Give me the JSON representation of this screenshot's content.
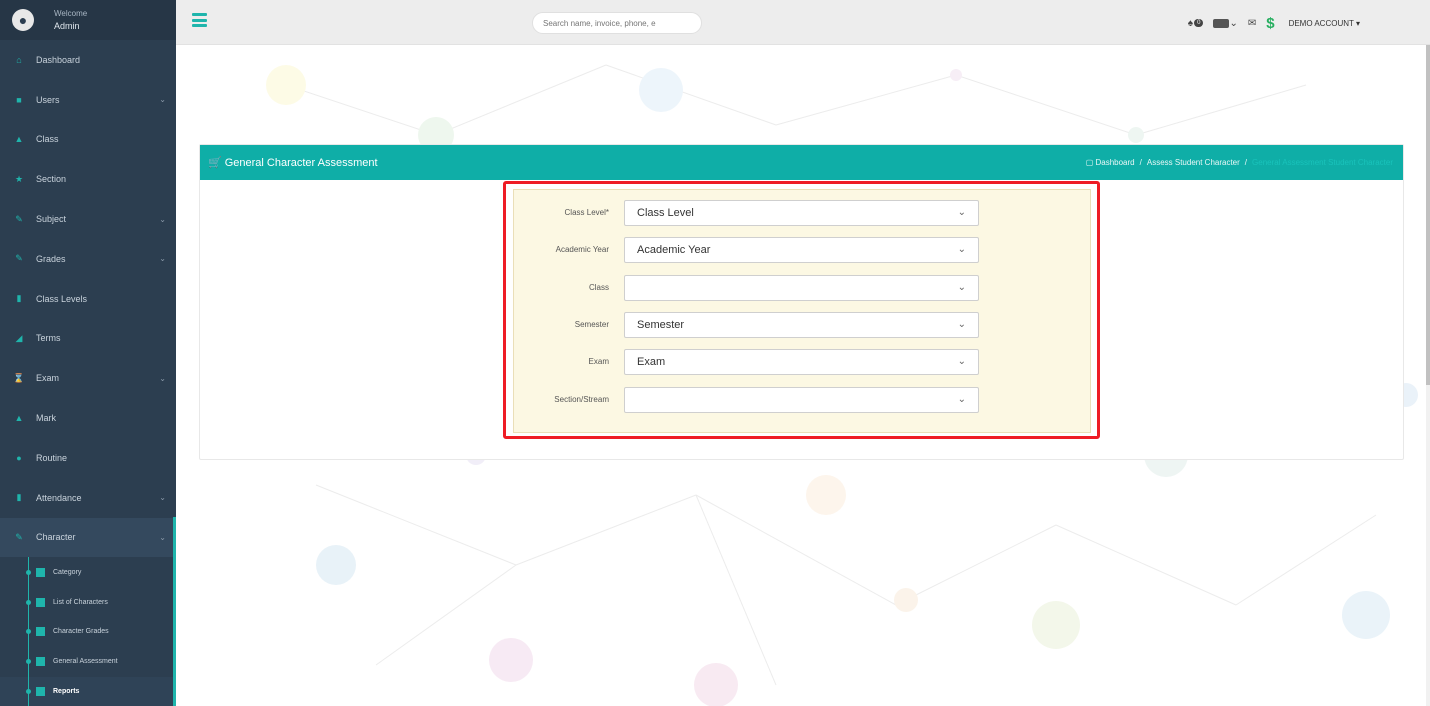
{
  "sidebar": {
    "welcome": "Welcome",
    "user": "Admin",
    "items": [
      {
        "label": "Dashboard",
        "icon": "home-icon"
      },
      {
        "label": "Users",
        "icon": "users-icon",
        "caret": true
      },
      {
        "label": "Class",
        "icon": "class-icon"
      },
      {
        "label": "Section",
        "icon": "star-icon"
      },
      {
        "label": "Subject",
        "icon": "edit-icon",
        "caret": true
      },
      {
        "label": "Grades",
        "icon": "edit-icon",
        "caret": true
      },
      {
        "label": "Class Levels",
        "icon": "level-icon"
      },
      {
        "label": "Terms",
        "icon": "chart-icon"
      },
      {
        "label": "Exam",
        "icon": "hourglass-icon",
        "caret": true
      },
      {
        "label": "Mark",
        "icon": "user-icon"
      },
      {
        "label": "Routine",
        "icon": "circle-icon"
      },
      {
        "label": "Attendance",
        "icon": "bookmark-icon",
        "caret": true
      },
      {
        "label": "Character",
        "icon": "edit-icon",
        "caret": true
      }
    ],
    "subitems": [
      {
        "label": "Category"
      },
      {
        "label": "List of Characters"
      },
      {
        "label": "Character Grades"
      },
      {
        "label": "General Assessment"
      },
      {
        "label": "Reports"
      }
    ]
  },
  "topbar": {
    "search_placeholder": "Search name, invoice, phone, e",
    "badge_count": "0",
    "account": "DEMO ACCOUNT ▾"
  },
  "panel": {
    "title": "General Character Assessment",
    "breadcrumb": [
      "Dashboard",
      "Assess Student Character",
      "General Assessment Student Character"
    ]
  },
  "form": {
    "fields": [
      {
        "label": "Class Level*",
        "value": "Class Level"
      },
      {
        "label": "Academic Year",
        "value": "Academic Year"
      },
      {
        "label": "Class",
        "value": ""
      },
      {
        "label": "Semester",
        "value": "Semester"
      },
      {
        "label": "Exam",
        "value": "Exam"
      },
      {
        "label": "Section/Stream",
        "value": ""
      }
    ]
  },
  "colors": {
    "sidebar": "#2c3e50",
    "accent": "#1fb5ac",
    "panel_header": "#0faea7",
    "form_bg": "#fcf8e3",
    "highlight": "#ee1c25"
  }
}
